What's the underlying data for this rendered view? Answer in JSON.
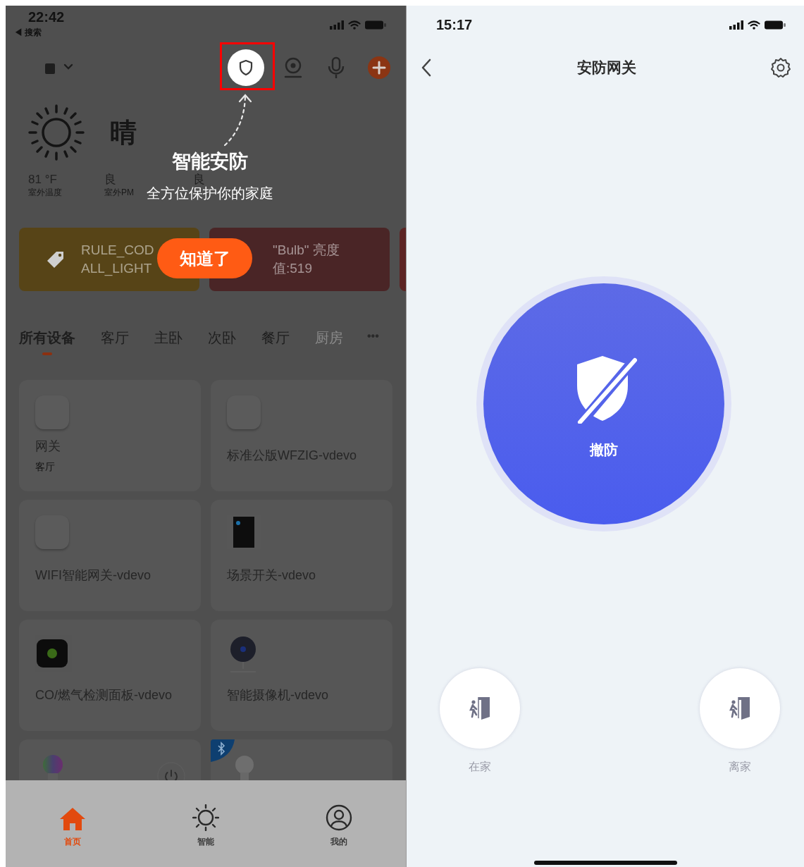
{
  "left_screen": {
    "status_bar": {
      "time": "22:42",
      "back_label": "◀ 搜索"
    },
    "header": {
      "actions": [
        {
          "kind": "shield",
          "highlighted": true
        },
        {
          "kind": "camera",
          "highlighted": false
        },
        {
          "kind": "mic",
          "highlighted": false
        },
        {
          "kind": "add",
          "highlighted": false
        }
      ]
    },
    "weather": {
      "condition": "晴",
      "stats": [
        {
          "value": "81 °F",
          "label": "室外温度"
        },
        {
          "value": "良",
          "label": "室外PM"
        },
        {
          "value": "良"
        }
      ]
    },
    "scenes": [
      {
        "kind": "tag",
        "color": "#574417",
        "lines": [
          "RULE_COD",
          "ALL_LIGHT"
        ]
      },
      {
        "kind": "plain",
        "color": "#4a2526",
        "lines": [
          "\"Bulb\" 亮度",
          "值:519"
        ]
      },
      {
        "kind": "plain",
        "color": "#5c2424"
      }
    ],
    "room_tabs": [
      {
        "label": "所有设备",
        "selected": true,
        "faded": false
      },
      {
        "label": "客厅",
        "selected": false,
        "faded": false
      },
      {
        "label": "主卧",
        "selected": false,
        "faded": false
      },
      {
        "label": "次卧",
        "selected": false,
        "faded": false
      },
      {
        "label": "餐厅",
        "selected": false,
        "faded": false
      },
      {
        "label": "厨房",
        "selected": false,
        "faded": true
      }
    ],
    "more_label": "•••",
    "devices": [
      {
        "kind": "hub",
        "name": "网关",
        "room": "客厅"
      },
      {
        "kind": "hub",
        "name": "标准公版WFZIG-vdevo"
      },
      {
        "kind": "hub",
        "name": "WIFI智能网关-vdevo"
      },
      {
        "kind": "panel",
        "name": "场景开关-vdevo"
      },
      {
        "kind": "detector",
        "name": "CO/燃气检测面板-vdevo"
      },
      {
        "kind": "camera",
        "name": "智能摄像机-vdevo"
      },
      {
        "kind": "color-bulb"
      },
      {
        "kind": "bluetooth-bulb"
      }
    ],
    "tab_bar": [
      {
        "kind": "home",
        "label": "首页",
        "selected": true
      },
      {
        "kind": "smart",
        "label": "智能",
        "selected": false
      },
      {
        "kind": "me",
        "label": "我的",
        "selected": false
      }
    ],
    "guide": {
      "title": "智能安防",
      "subtitle": "全方位保护你的家庭",
      "button": "知道了"
    }
  },
  "right_screen": {
    "status_bar": {
      "time": "15:17"
    },
    "title": "安防网关",
    "arm_button": {
      "label": "撤防"
    },
    "modes": [
      {
        "label": "在家"
      },
      {
        "label": "离家"
      }
    ]
  }
}
